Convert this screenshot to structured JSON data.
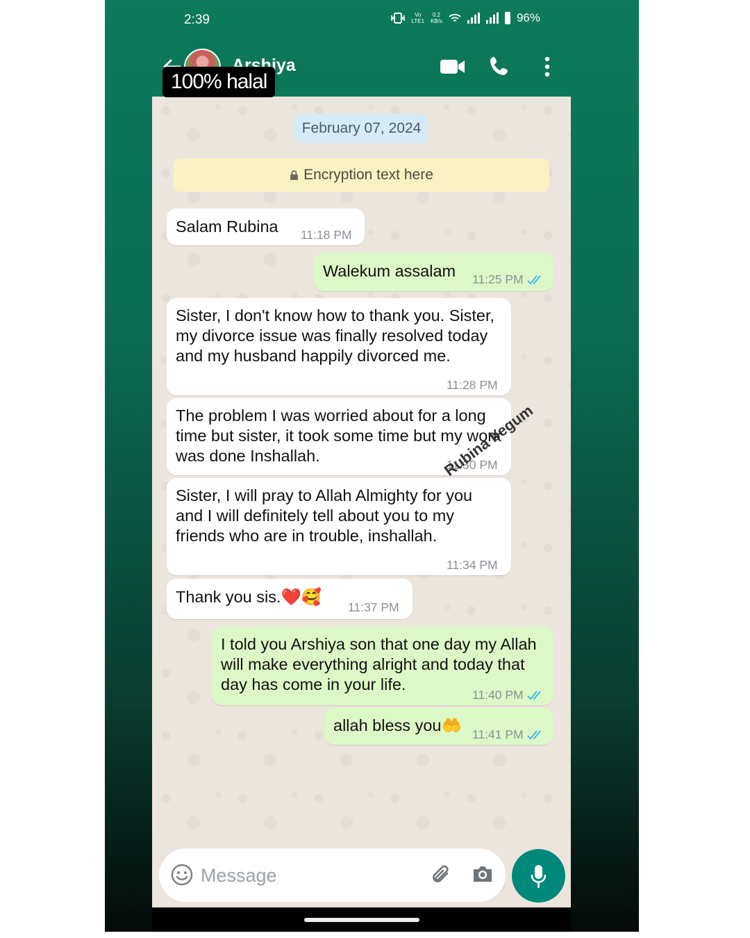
{
  "status_bar": {
    "time": "2:39",
    "volte": "Voʙ\nLTE1",
    "speed": "0.2\nKB/s",
    "battery": "96%"
  },
  "header": {
    "contact_name": "Arshiya",
    "icons": [
      "back-arrow-icon",
      "video-call-icon",
      "phone-icon",
      "more-options-icon"
    ]
  },
  "overlay_caption": "100% halal",
  "chat": {
    "date_chip": "February 07, 2024",
    "encryption_notice": "Encryption text here",
    "messages": [
      {
        "direction": "incoming",
        "text": "Salam Rubina",
        "time": "11:18 PM"
      },
      {
        "direction": "outgoing",
        "text": "Walekum assalam",
        "time": "11:25 PM",
        "read": true
      },
      {
        "direction": "incoming",
        "text": "Sister, I don't know how to thank you. Sister, my divorce issue was finally resolved today and my husband happily divorced me.",
        "time": "11:28 PM"
      },
      {
        "direction": "incoming",
        "text": "The problem I was worried about for a long time but sister, it took some time but my work was done Inshallah.",
        "time": "11:30 PM"
      },
      {
        "direction": "incoming",
        "text": "Sister, I will pray to Allah Almighty for you and I will definitely tell about you to my friends who are in trouble, inshallah.",
        "time": "11:34 PM"
      },
      {
        "direction": "incoming",
        "text": "Thank you sis.❤️🥰",
        "time": "11:37 PM"
      },
      {
        "direction": "outgoing",
        "text": "I told you Arshiya son that one day my Allah will make everything alright and today that day has come in your life.",
        "time": "11:40 PM",
        "read": true
      },
      {
        "direction": "outgoing",
        "text": "allah bless you🤲",
        "time": "11:41 PM",
        "read": true
      }
    ]
  },
  "watermark": "Rubina begum",
  "composer": {
    "placeholder": "Message",
    "icons": [
      "emoji-icon",
      "attach-icon",
      "camera-icon",
      "mic-icon"
    ]
  },
  "colors": {
    "frame_green": "#0b6c52",
    "incoming_bubble": "#ffffff",
    "outgoing_bubble": "#dcf8c6",
    "mic_button": "#00897b",
    "read_ticks": "#34b7f1"
  }
}
